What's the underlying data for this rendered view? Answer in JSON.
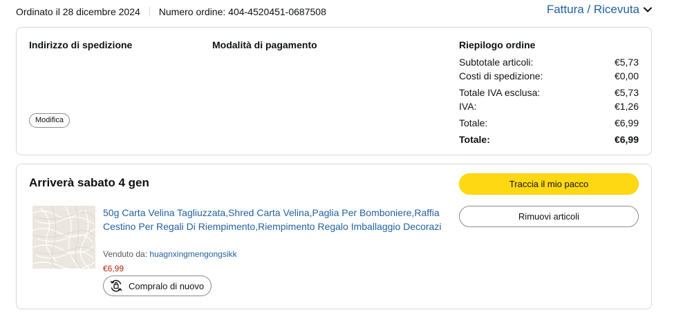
{
  "header": {
    "ordered_on": "Ordinato il 28 dicembre 2024",
    "order_number": "Numero ordine: 404-4520451-0687508",
    "invoice_link": "Fattura / Ricevuta",
    "invoice_icon": "chevron-down-icon"
  },
  "details": {
    "shipping_title": "Indirizzo di spedizione",
    "payment_title": "Modalità di pagamento",
    "summary_title": "Riepilogo ordine",
    "edit_label": "Modifica",
    "summary": [
      {
        "label": "Subtotale articoli:",
        "value": "€5,73"
      },
      {
        "label": "Costi di spedizione:",
        "value": "€0,00"
      },
      {
        "label": "Totale IVA esclusa:",
        "value": "€5,73"
      },
      {
        "label": "IVA:",
        "value": "€1,26"
      },
      {
        "label": "Totale:",
        "value": "€6,99"
      },
      {
        "label": "Totale:",
        "value": "€6,99"
      }
    ]
  },
  "shipment": {
    "arrival": "Arriverà sabato 4 gen",
    "track_label": "Traccia il mio pacco",
    "remove_label": "Rimuovi articoli",
    "item": {
      "title": "50g Carta Velina Tagliuzzata,Shred Carta Velina,Paglia Per Bomboniere,Raffia Cestino Per Regali Di Riempimento,Riempimento Regalo Imballaggio Decorazi",
      "sold_by_label": "Venduto da:",
      "seller": "huagnxingmengongsikk",
      "price": "€6,99",
      "buy_again_label": "Compralo di nuovo",
      "buy_again_icon": "buy-again-icon"
    }
  },
  "colors": {
    "link": "#2162a1",
    "primary_button": "#ffd814",
    "price": "#b12704"
  }
}
